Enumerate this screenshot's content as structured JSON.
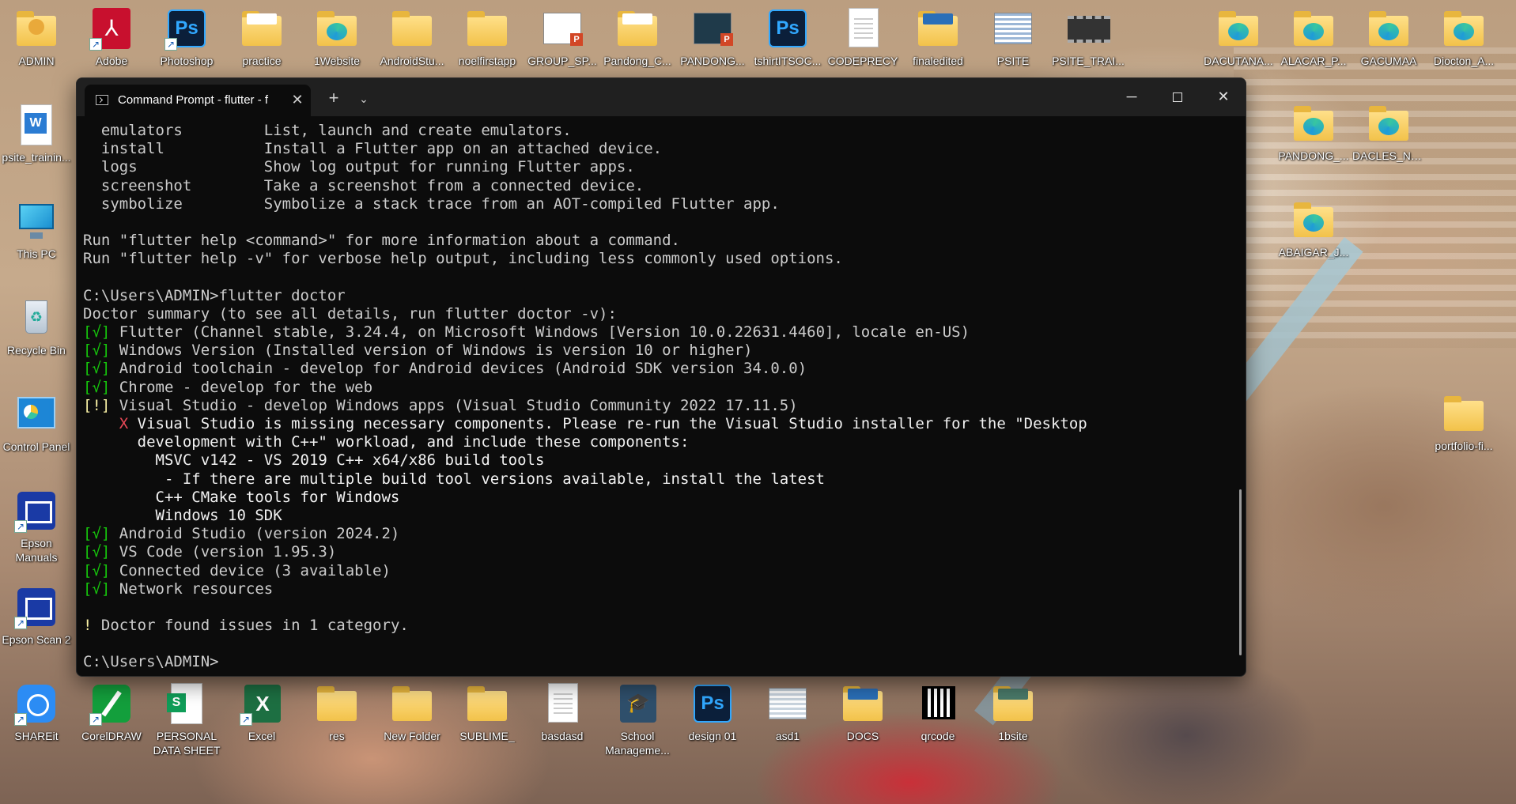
{
  "desktop": {
    "top_row": [
      {
        "label": "ADMIN",
        "icon": "user-folder-icon"
      },
      {
        "label": "Adobe",
        "icon": "adobe-pdf-icon"
      },
      {
        "label": "Photoshop",
        "icon": "photoshop-icon"
      },
      {
        "label": "practice",
        "icon": "folder-icon"
      },
      {
        "label": "1Website",
        "icon": "edge-folder-icon"
      },
      {
        "label": "AndroidStu...",
        "icon": "folder-icon"
      },
      {
        "label": "noelfirstapp",
        "icon": "folder-icon"
      },
      {
        "label": "GROUP_SP...",
        "icon": "powerpoint-file-icon"
      },
      {
        "label": "Pandong_C...",
        "icon": "folder-icon"
      },
      {
        "label": "PANDONG...",
        "icon": "powerpoint-file-icon"
      },
      {
        "label": "tshirtITSOC...",
        "icon": "photoshop-icon"
      },
      {
        "label": "CODEPRECY",
        "icon": "document-icon"
      },
      {
        "label": "finaledited",
        "icon": "folder-icon"
      },
      {
        "label": "PSITE",
        "icon": "image-file-icon"
      },
      {
        "label": "PSITE_TRAI...",
        "icon": "video-file-icon"
      }
    ],
    "left_column": [
      {
        "label": "psite_trainin...",
        "icon": "word-document-icon"
      },
      {
        "label": "This PC",
        "icon": "computer-icon"
      },
      {
        "label": "Recycle Bin",
        "icon": "recycle-bin-icon"
      },
      {
        "label": "Control Panel",
        "icon": "control-panel-icon"
      },
      {
        "label": "Epson Manuals",
        "icon": "epson-manuals-icon"
      },
      {
        "label": "Epson Scan 2",
        "icon": "epson-scan-icon"
      }
    ],
    "right_icons": [
      {
        "label": "DACUTANA...",
        "icon": "edge-folder-icon"
      },
      {
        "label": "ALACAR_P...",
        "icon": "edge-folder-icon"
      },
      {
        "label": "GACUMAA",
        "icon": "edge-folder-icon"
      },
      {
        "label": "Diocton_A...",
        "icon": "edge-folder-icon"
      },
      {
        "label": "PANDONG_...",
        "icon": "edge-folder-icon"
      },
      {
        "label": "DACLES_NE...",
        "icon": "edge-folder-icon"
      },
      {
        "label": "ABAIGAR_J...",
        "icon": "edge-folder-icon"
      },
      {
        "label": "portfolio-fi...",
        "icon": "folder-icon"
      }
    ],
    "bottom_row": [
      {
        "label": "SHAREit",
        "icon": "shareit-icon"
      },
      {
        "label": "CorelDRAW",
        "icon": "coreldraw-icon"
      },
      {
        "label": "PERSONAL DATA SHEET",
        "icon": "sheets-file-icon"
      },
      {
        "label": "Excel",
        "icon": "excel-icon"
      },
      {
        "label": "res",
        "icon": "folder-icon"
      },
      {
        "label": "New Folder",
        "icon": "folder-icon"
      },
      {
        "label": "SUBLIME_",
        "icon": "folder-icon"
      },
      {
        "label": "basdasd",
        "icon": "document-icon"
      },
      {
        "label": "School Manageme...",
        "icon": "school-app-icon"
      },
      {
        "label": "design 01",
        "icon": "photoshop-icon"
      },
      {
        "label": "asd1",
        "icon": "image-file-icon"
      },
      {
        "label": "DOCS",
        "icon": "folder-icon"
      },
      {
        "label": "qrcode",
        "icon": "qr-code-icon"
      },
      {
        "label": "1bsite",
        "icon": "folder-icon"
      }
    ]
  },
  "window": {
    "tab_title": "Command Prompt - flutter - f",
    "tab_close": "✕",
    "new_tab": "+",
    "dropdown": "⌄",
    "minimize": "─",
    "close": "✕"
  },
  "terminal": {
    "lines": [
      {
        "text": "  emulators         List, launch and create emulators."
      },
      {
        "text": "  install           Install a Flutter app on an attached device."
      },
      {
        "text": "  logs              Show log output for running Flutter apps."
      },
      {
        "text": "  screenshot        Take a screenshot from a connected device."
      },
      {
        "text": "  symbolize         Symbolize a stack trace from an AOT-compiled Flutter app."
      },
      {
        "text": ""
      },
      {
        "text": "Run \"flutter help <command>\" for more information about a command."
      },
      {
        "text": "Run \"flutter help -v\" for verbose help output, including less commonly used options."
      },
      {
        "text": ""
      },
      {
        "text": "C:\\Users\\ADMIN>flutter doctor"
      },
      {
        "text": "Doctor summary (to see all details, run flutter doctor -v):"
      },
      {
        "mark": "[√]",
        "color": "green",
        "text": " Flutter (Channel stable, 3.24.4, on Microsoft Windows [Version 10.0.22631.4460], locale en-US)"
      },
      {
        "mark": "[√]",
        "color": "green",
        "text": " Windows Version (Installed version of Windows is version 10 or higher)"
      },
      {
        "mark": "[√]",
        "color": "green",
        "text": " Android toolchain - develop for Android devices (Android SDK version 34.0.0)"
      },
      {
        "mark": "[√]",
        "color": "green",
        "text": " Chrome - develop for the web"
      },
      {
        "mark": "[!]",
        "color": "yellow",
        "text": " Visual Studio - develop Windows apps (Visual Studio Community 2022 17.11.5)"
      },
      {
        "indent": "    ",
        "mark": "X",
        "color": "red",
        "text": " Visual Studio is missing necessary components. Please re-run the Visual Studio installer for the \"Desktop",
        "bright": true
      },
      {
        "text": "      development with C++\" workload, and include these components:",
        "bright": true
      },
      {
        "text": "        MSVC v142 - VS 2019 C++ x64/x86 build tools",
        "bright": true
      },
      {
        "text": "         - If there are multiple build tool versions available, install the latest",
        "bright": true
      },
      {
        "text": "        C++ CMake tools for Windows",
        "bright": true
      },
      {
        "text": "        Windows 10 SDK",
        "bright": true
      },
      {
        "mark": "[√]",
        "color": "green",
        "text": " Android Studio (version 2024.2)"
      },
      {
        "mark": "[√]",
        "color": "green",
        "text": " VS Code (version 1.95.3)"
      },
      {
        "mark": "[√]",
        "color": "green",
        "text": " Connected device (3 available)"
      },
      {
        "mark": "[√]",
        "color": "green",
        "text": " Network resources"
      },
      {
        "text": ""
      },
      {
        "mark": "!",
        "color": "yellow",
        "text": " Doctor found issues in 1 category."
      },
      {
        "text": ""
      },
      {
        "text": "C:\\Users\\ADMIN>"
      }
    ]
  }
}
